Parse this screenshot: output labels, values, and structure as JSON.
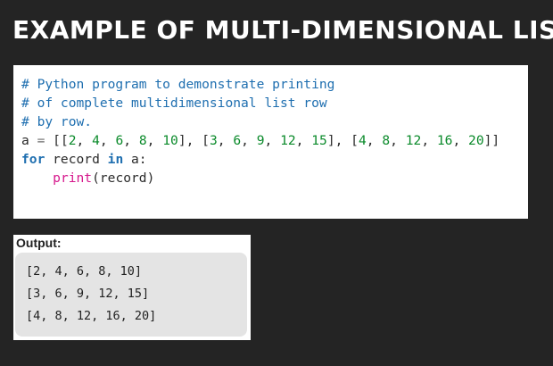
{
  "title": "EXAMPLE OF MULTI-DIMENSIONAL LIST",
  "code": {
    "lines": [
      [
        {
          "t": "# Python program to demonstrate printing",
          "c": "comment"
        }
      ],
      [
        {
          "t": "# of complete multidimensional list row",
          "c": "comment"
        }
      ],
      [
        {
          "t": "# by row.",
          "c": "comment"
        }
      ],
      [
        {
          "t": "a ",
          "c": "plain"
        },
        {
          "t": "=",
          "c": "op"
        },
        {
          "t": " [[",
          "c": "plain"
        },
        {
          "t": "2",
          "c": "num"
        },
        {
          "t": ", ",
          "c": "plain"
        },
        {
          "t": "4",
          "c": "num"
        },
        {
          "t": ", ",
          "c": "plain"
        },
        {
          "t": "6",
          "c": "num"
        },
        {
          "t": ", ",
          "c": "plain"
        },
        {
          "t": "8",
          "c": "num"
        },
        {
          "t": ", ",
          "c": "plain"
        },
        {
          "t": "10",
          "c": "num"
        },
        {
          "t": "], [",
          "c": "plain"
        },
        {
          "t": "3",
          "c": "num"
        },
        {
          "t": ", ",
          "c": "plain"
        },
        {
          "t": "6",
          "c": "num"
        },
        {
          "t": ", ",
          "c": "plain"
        },
        {
          "t": "9",
          "c": "num"
        },
        {
          "t": ", ",
          "c": "plain"
        },
        {
          "t": "12",
          "c": "num"
        },
        {
          "t": ", ",
          "c": "plain"
        },
        {
          "t": "15",
          "c": "num"
        },
        {
          "t": "], [",
          "c": "plain"
        },
        {
          "t": "4",
          "c": "num"
        },
        {
          "t": ", ",
          "c": "plain"
        },
        {
          "t": "8",
          "c": "num"
        },
        {
          "t": ", ",
          "c": "plain"
        },
        {
          "t": "12",
          "c": "num"
        },
        {
          "t": ", ",
          "c": "plain"
        },
        {
          "t": "16",
          "c": "num"
        },
        {
          "t": ", ",
          "c": "plain"
        },
        {
          "t": "20",
          "c": "num"
        },
        {
          "t": "]]",
          "c": "plain"
        }
      ],
      [
        {
          "t": "for",
          "c": "kw"
        },
        {
          "t": " record ",
          "c": "plain"
        },
        {
          "t": "in",
          "c": "kw"
        },
        {
          "t": " a:",
          "c": "plain"
        }
      ],
      [
        {
          "t": "    ",
          "c": "plain"
        },
        {
          "t": "print",
          "c": "func"
        },
        {
          "t": "(record)",
          "c": "plain"
        }
      ]
    ]
  },
  "output": {
    "label": "Output:",
    "lines": [
      "[2, 4, 6, 8, 10]",
      "[3, 6, 9, 12, 15]",
      "[4, 8, 12, 16, 20]"
    ]
  },
  "colors": {
    "background": "#242424",
    "comment": "#1f6fb0",
    "keyword": "#1f6fb0",
    "number": "#0a8a2a",
    "function": "#d6178c"
  }
}
